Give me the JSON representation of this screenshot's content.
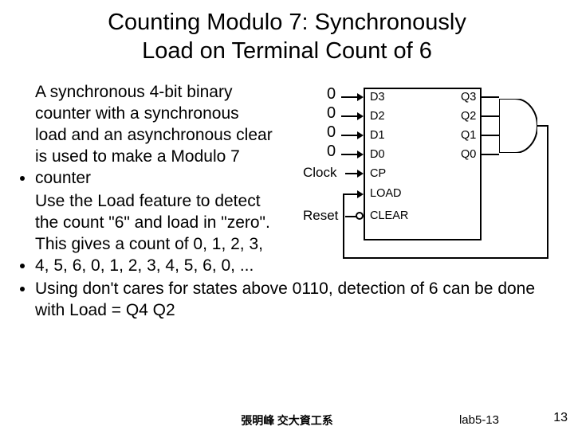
{
  "title": "Counting Modulo 7: Synchronously\nLoad on Terminal Count of 6",
  "bullets": {
    "b1": "A synchronous 4-bit binary counter with a synchronous load and an asynchronous clear is used to make a Modulo 7 counter",
    "b2": "Use the Load feature to detect the count \"6\" and load in \"zero\".   This gives a count of 0, 1, 2, 3, 4, 5, 6, 0, 1, 2, 3, 4, 5, 6, 0, ...",
    "b3": "Using don't cares for states above 0110, detection of 6 can be done with Load = Q4 Q2"
  },
  "diagram": {
    "inputs": {
      "d3": "0",
      "d2": "0",
      "d1": "0",
      "d0": "0",
      "clock": "Clock",
      "reset": "Reset"
    },
    "pins_left": {
      "d3": "D3",
      "d2": "D2",
      "d1": "D1",
      "d0": "D0",
      "cp": "CP",
      "load": "LOAD",
      "clear": "CLEAR"
    },
    "pins_right": {
      "q3": "Q3",
      "q2": "Q2",
      "q1": "Q1",
      "q0": "Q0"
    }
  },
  "footer": {
    "pageNum": "13",
    "slideId": "lab5-13",
    "author": "張明峰 交大資工系"
  }
}
